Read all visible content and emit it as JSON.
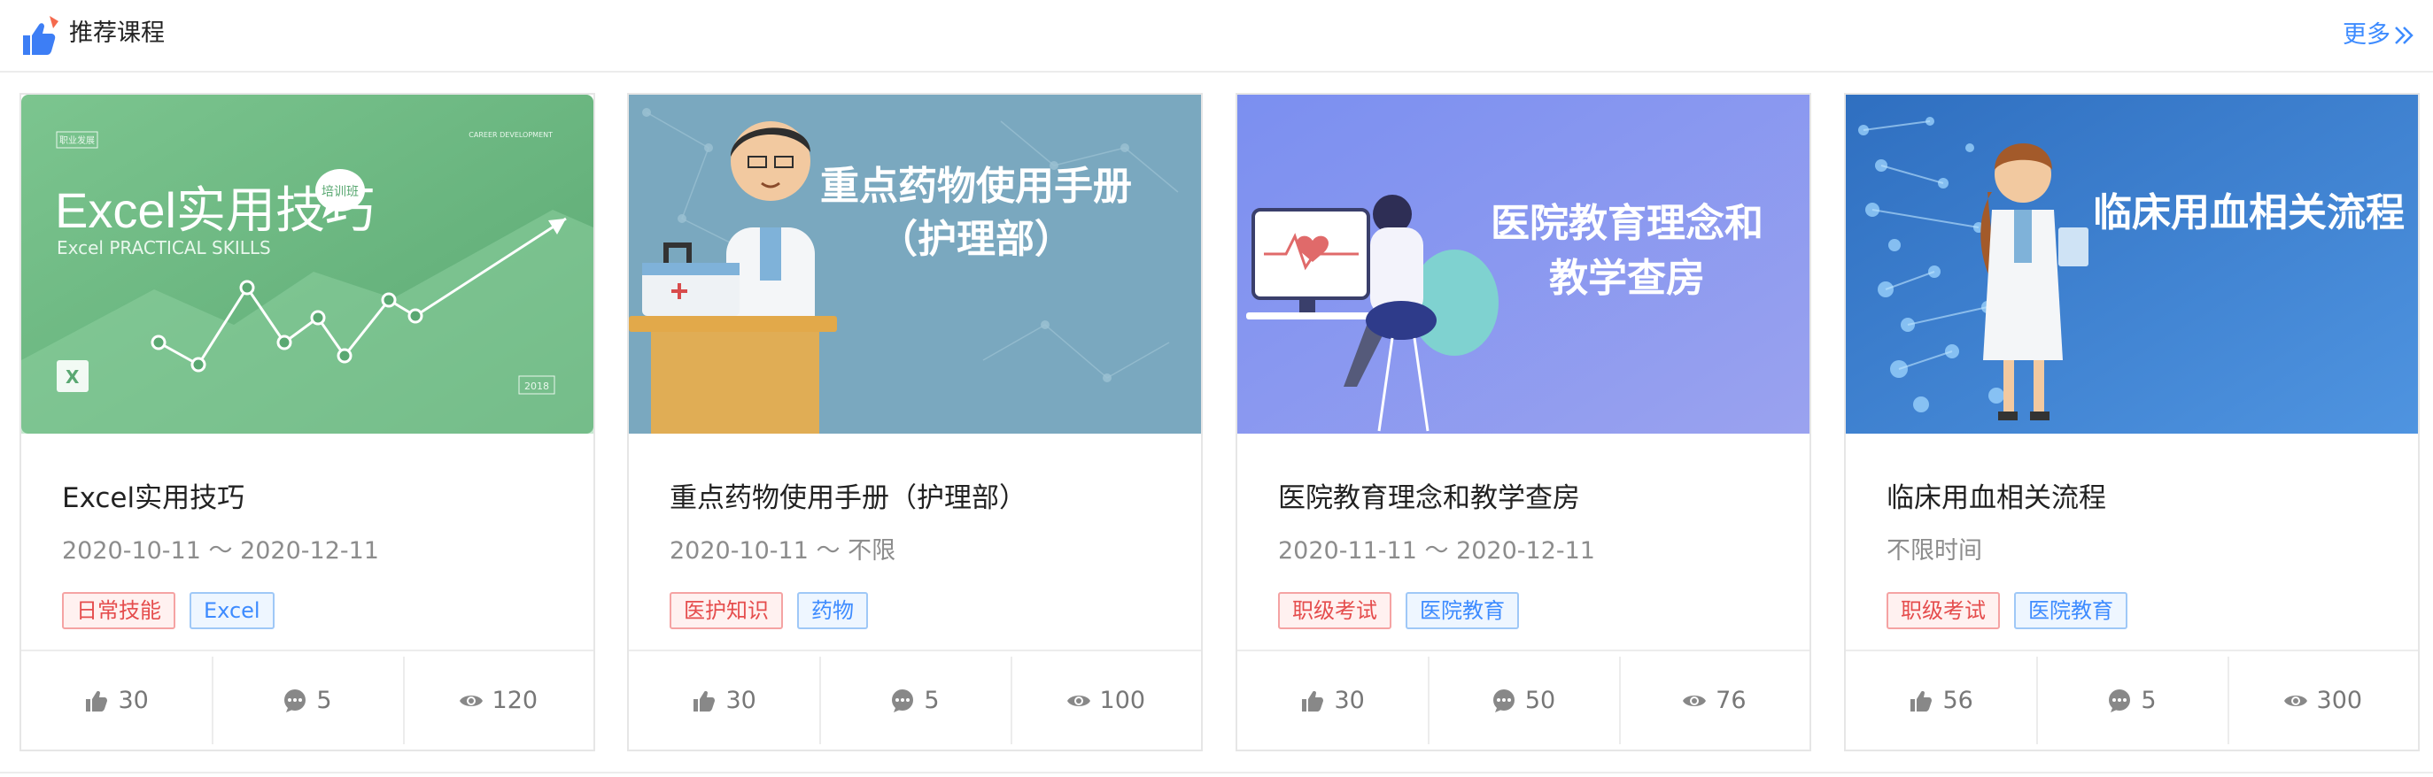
{
  "header": {
    "title": "推荐课程",
    "more_label": "更多"
  },
  "colors": {
    "accent": "#3d8bff",
    "tag_red": "#e54d4d",
    "tag_blue": "#3d8bff"
  },
  "courses": [
    {
      "banner": {
        "corner_left": "职业发展",
        "corner_right": "CAREER DEVELOPMENT",
        "headline": "Excel实用技巧",
        "subheadline": "Excel PRACTICAL SKILLS",
        "badge": "培训班",
        "year": "2018"
      },
      "title": "Excel实用技巧",
      "date": "2020-10-11 ～ 2020-12-11",
      "tags": [
        {
          "label": "日常技能",
          "color": "red"
        },
        {
          "label": "Excel",
          "color": "blue"
        }
      ],
      "likes": "30",
      "comments": "5",
      "views": "120"
    },
    {
      "banner": {
        "headline_line1": "重点药物使用手册",
        "headline_line2": "（护理部）"
      },
      "title": "重点药物使用手册（护理部）",
      "date": "2020-10-11 ～ 不限",
      "tags": [
        {
          "label": "医护知识",
          "color": "red"
        },
        {
          "label": "药物",
          "color": "blue"
        }
      ],
      "likes": "30",
      "comments": "5",
      "views": "100"
    },
    {
      "banner": {
        "headline_line1": "医院教育理念和",
        "headline_line2": "教学查房"
      },
      "title": "医院教育理念和教学查房",
      "date": "2020-11-11 ～ 2020-12-11",
      "tags": [
        {
          "label": "职级考试",
          "color": "red"
        },
        {
          "label": "医院教育",
          "color": "blue"
        }
      ],
      "likes": "30",
      "comments": "50",
      "views": "76"
    },
    {
      "banner": {
        "headline": "临床用血相关流程"
      },
      "title": "临床用血相关流程",
      "date": "不限时间",
      "tags": [
        {
          "label": "职级考试",
          "color": "red"
        },
        {
          "label": "医院教育",
          "color": "blue"
        }
      ],
      "likes": "56",
      "comments": "5",
      "views": "300"
    }
  ]
}
